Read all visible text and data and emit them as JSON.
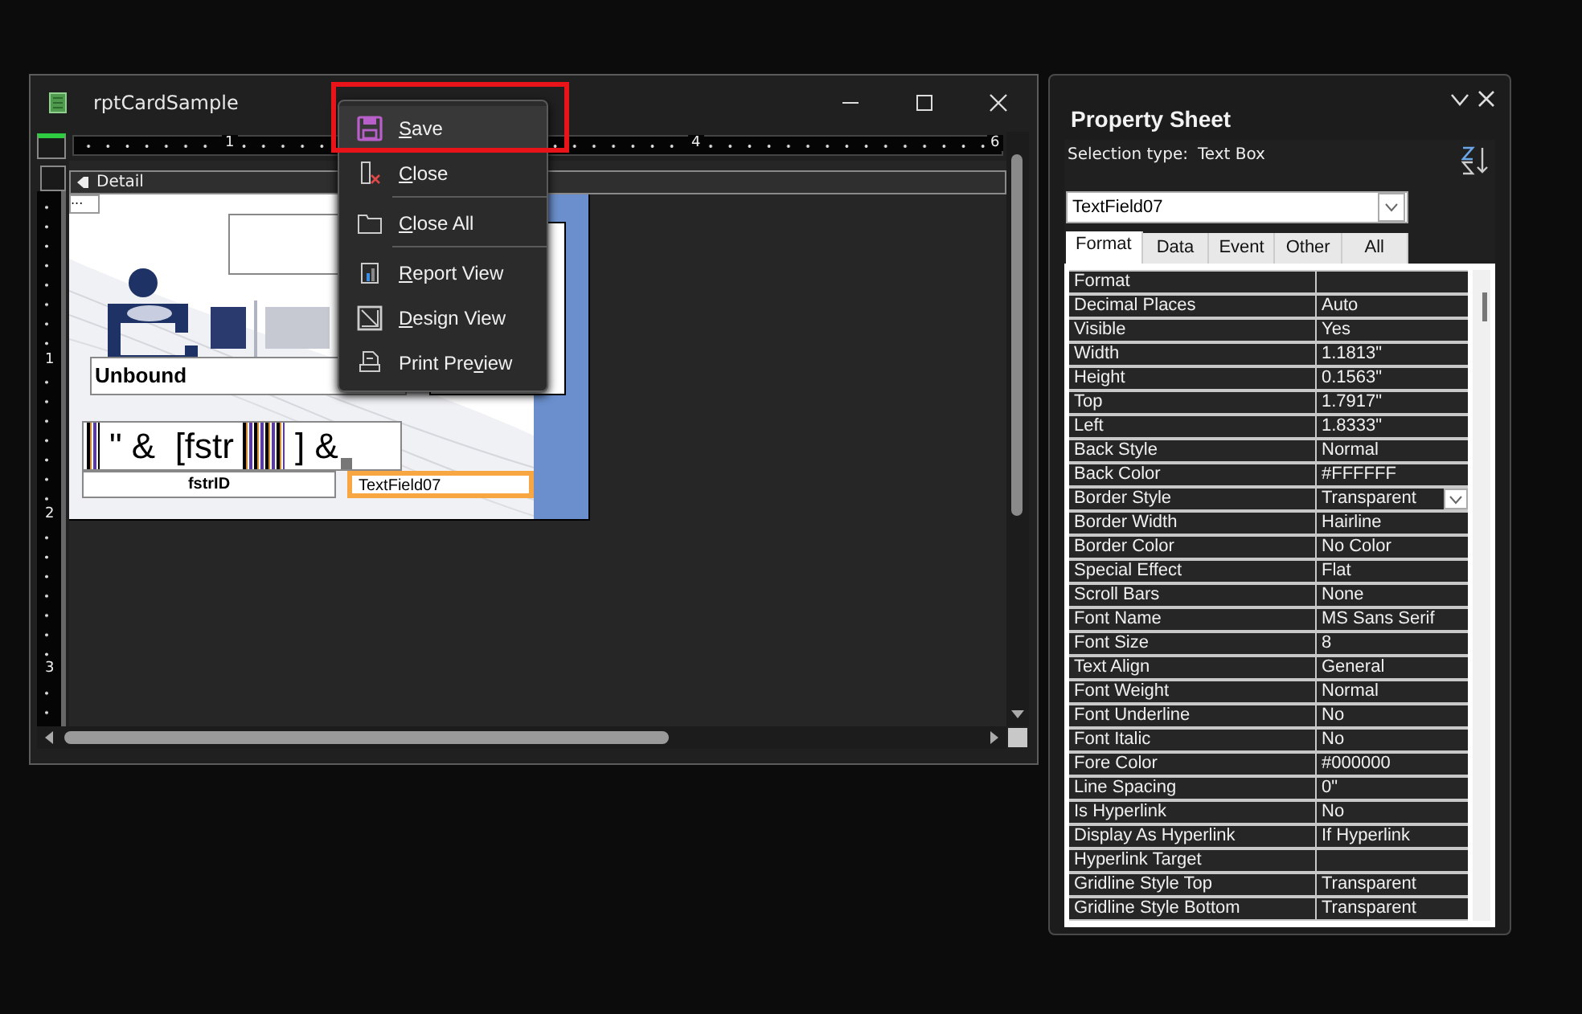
{
  "report_window": {
    "title": "rptCardSample",
    "ruler_marks": [
      "1",
      "4",
      "6"
    ],
    "vertical_ruler_marks": [
      "1",
      "2",
      "3"
    ],
    "section": "Detail",
    "canvas_tab": "...",
    "controls": [
      {
        "kind": "box",
        "selected": false
      },
      {
        "kind": "box",
        "selected": false
      },
      {
        "kind": "label",
        "text": "Unbound",
        "selected": false
      },
      {
        "kind": "barcode",
        "text": "\" &  [fstr",
        "text_2": "] &",
        "selected": false
      },
      {
        "kind": "label",
        "text": "fstrID",
        "selected": false
      },
      {
        "kind": "textbox",
        "text": "TextField07",
        "selected": true
      }
    ]
  },
  "context_menu": {
    "items": [
      {
        "key": "S",
        "post": "ave",
        "separator_before": false,
        "selected": true,
        "marked": true
      },
      {
        "key": "C",
        "post": "lose",
        "separator_before": false,
        "selected": false,
        "marked": false
      },
      {
        "key": "C",
        "post": "lose All",
        "separator_before": true,
        "selected": false,
        "marked": false
      },
      {
        "key": "R",
        "post": "eport View",
        "separator_before": true,
        "selected": false,
        "marked": false
      },
      {
        "key": "D",
        "post": "esign View",
        "separator_before": false,
        "selected": false,
        "marked": false
      },
      {
        "pre": "Print Pre",
        "key": "v",
        "post": "iew",
        "separator_before": false,
        "selected": false,
        "marked": false
      }
    ]
  },
  "property_sheet": {
    "title": "Property Sheet",
    "selection_label": "Selection type:",
    "selection_type": "Text Box",
    "object": "TextField07",
    "tabs": [
      {
        "label": "Format",
        "selected": true
      },
      {
        "label": "Data",
        "selected": false
      },
      {
        "label": "Event",
        "selected": false
      },
      {
        "label": "Other",
        "selected": false
      },
      {
        "label": "All",
        "selected": false
      }
    ],
    "properties": [
      {
        "name": "Format",
        "active": false
      },
      {
        "name": "Decimal Places",
        "value": "Auto",
        "active": false
      },
      {
        "name": "Visible",
        "value": "Yes",
        "active": false
      },
      {
        "name": "Width",
        "value": "1.1813\"",
        "active": false
      },
      {
        "name": "Height",
        "value": "0.1563\"",
        "active": false
      },
      {
        "name": "Top",
        "value": "1.7917\"",
        "active": false
      },
      {
        "name": "Left",
        "value": "1.8333\"",
        "active": false
      },
      {
        "name": "Back Style",
        "value": "Normal",
        "active": false
      },
      {
        "name": "Back Color",
        "value": "#FFFFFF",
        "active": false
      },
      {
        "name": "Border Style",
        "value": "Transparent",
        "active": true
      },
      {
        "name": "Border Width",
        "value": "Hairline",
        "active": false
      },
      {
        "name": "Border Color",
        "value": "No Color",
        "active": false
      },
      {
        "name": "Special Effect",
        "value": "Flat",
        "active": false
      },
      {
        "name": "Scroll Bars",
        "value": "None",
        "active": false
      },
      {
        "name": "Font Name",
        "value": "MS Sans Serif",
        "active": false
      },
      {
        "name": "Font Size",
        "value": "8",
        "active": false
      },
      {
        "name": "Text Align",
        "value": "General",
        "active": false
      },
      {
        "name": "Font Weight",
        "value": "Normal",
        "active": false
      },
      {
        "name": "Font Underline",
        "value": "No",
        "active": false
      },
      {
        "name": "Font Italic",
        "value": "No",
        "active": false
      },
      {
        "name": "Fore Color",
        "value": "#000000",
        "active": false
      },
      {
        "name": "Line Spacing",
        "value": "0\"",
        "active": false
      },
      {
        "name": "Is Hyperlink",
        "value": "No",
        "active": false
      },
      {
        "name": "Display As Hyperlink",
        "value": "If Hyperlink",
        "active": false
      },
      {
        "name": "Hyperlink Target",
        "active": false
      },
      {
        "name": "Gridline Style Top",
        "value": "Transparent",
        "active": false
      },
      {
        "name": "Gridline Style Bottom",
        "value": "Transparent",
        "active": false
      }
    ]
  }
}
